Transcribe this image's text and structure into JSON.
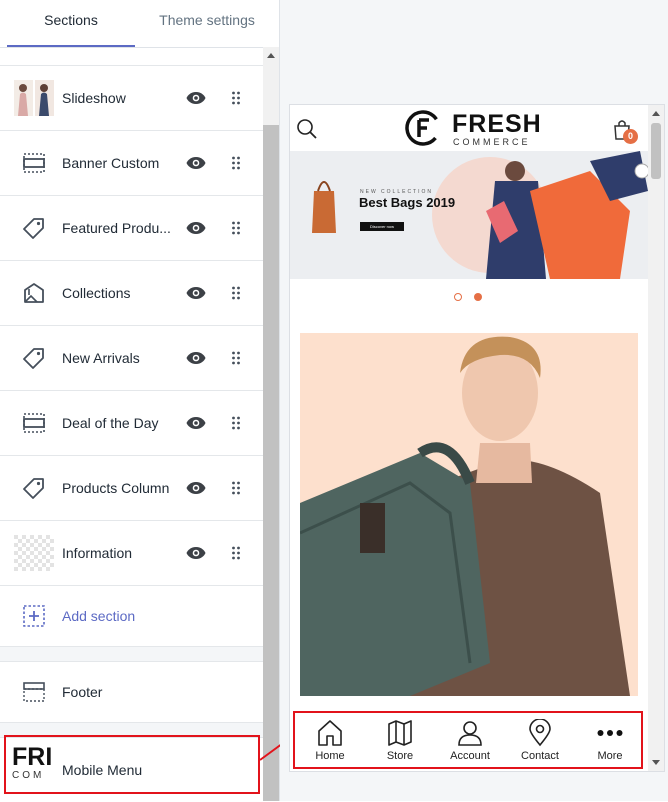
{
  "tabs": {
    "sections": "Sections",
    "theme_settings": "Theme settings"
  },
  "sections": [
    {
      "label": "Slideshow",
      "icon": "slideshow-thumbnail"
    },
    {
      "label": "Banner Custom",
      "icon": "banner-icon"
    },
    {
      "label": "Featured Produ...",
      "icon": "tag-icon"
    },
    {
      "label": "Collections",
      "icon": "collections-icon"
    },
    {
      "label": "New Arrivals",
      "icon": "tag-icon"
    },
    {
      "label": "Deal of the Day",
      "icon": "banner-icon"
    },
    {
      "label": "Products Column",
      "icon": "tag-icon"
    },
    {
      "label": "Information",
      "icon": "image-placeholder"
    }
  ],
  "add_section": "Add section",
  "footer": "Footer",
  "mobile_menu": {
    "label": "Mobile Menu",
    "thumb_text_top": "FRI",
    "thumb_text_bottom": "COM"
  },
  "preview": {
    "logo_main": "FRESH",
    "logo_sub": "COMMERCE",
    "cart_count": "0",
    "banner": {
      "subtitle": "NEW COLLECTION",
      "title": "Best Bags 2019",
      "button": "Discover now"
    },
    "bottom_nav": [
      {
        "label": "Home",
        "icon": "home-icon"
      },
      {
        "label": "Store",
        "icon": "map-icon"
      },
      {
        "label": "Account",
        "icon": "user-icon"
      },
      {
        "label": "Contact",
        "icon": "location-pin-icon"
      },
      {
        "label": "More",
        "icon": "more-dots-icon"
      }
    ]
  },
  "colors": {
    "accent": "#5c6ac4",
    "highlight": "#e2131b",
    "brand_orange": "#e56f45"
  }
}
